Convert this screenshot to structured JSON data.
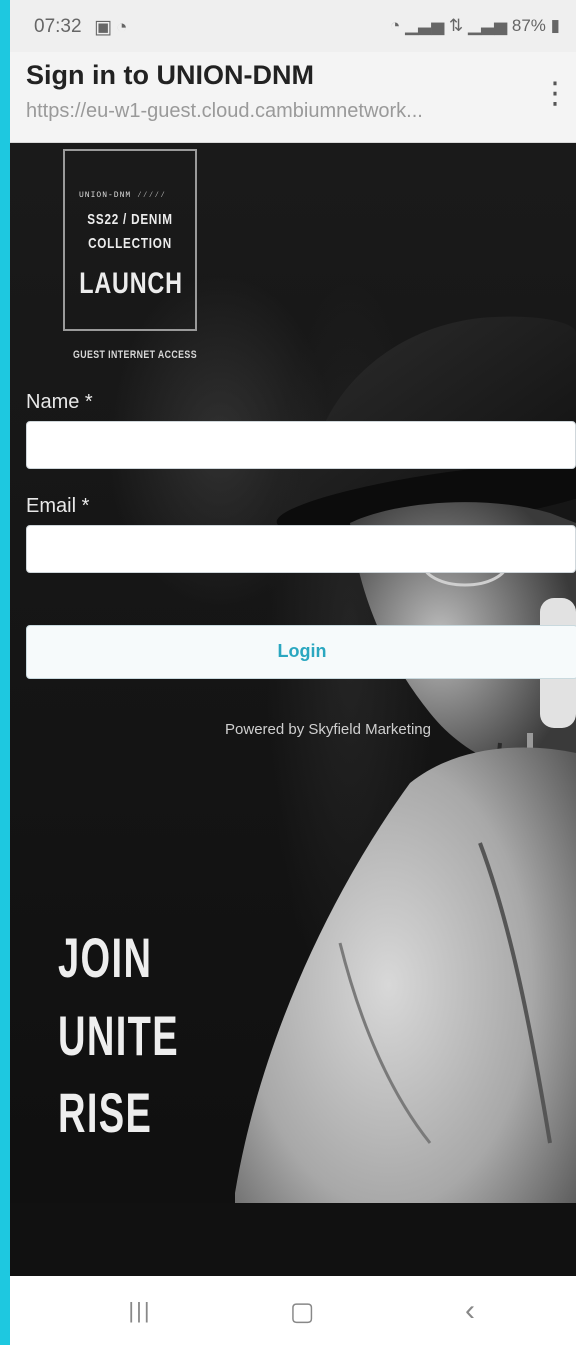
{
  "status_bar": {
    "time": "07:32",
    "left_icons": [
      "gallery-icon",
      "wifi-icon"
    ],
    "battery": "87%",
    "right_icons": [
      "wifi-call-icon",
      "volte-icon",
      "signal-icon",
      "lte-icon",
      "signal-icon-2",
      "battery-icon"
    ]
  },
  "header": {
    "title": "Sign in to UNION-DNM",
    "url": "https://eu-w1-guest.cloud.cambiumnetwork...",
    "menu_icon": "more-vert-icon"
  },
  "logo": {
    "small_text": "UNION-DNM ⁄⁄⁄⁄⁄",
    "line1": "SS22 / DENIM",
    "line2": "COLLECTION",
    "line3": "LAUNCH",
    "caption": "GUEST INTERNET ACCESS"
  },
  "form": {
    "name_label": "Name *",
    "name_value": "",
    "email_label": "Email *",
    "email_value": "",
    "login_label": "Login"
  },
  "footer_text": "Powered by Skyfield Marketing",
  "slogan": [
    "JOIN",
    "UNITE",
    "RISE"
  ],
  "nav": {
    "recents": "recent-apps-icon",
    "home": "home-icon",
    "back": "back-icon"
  }
}
